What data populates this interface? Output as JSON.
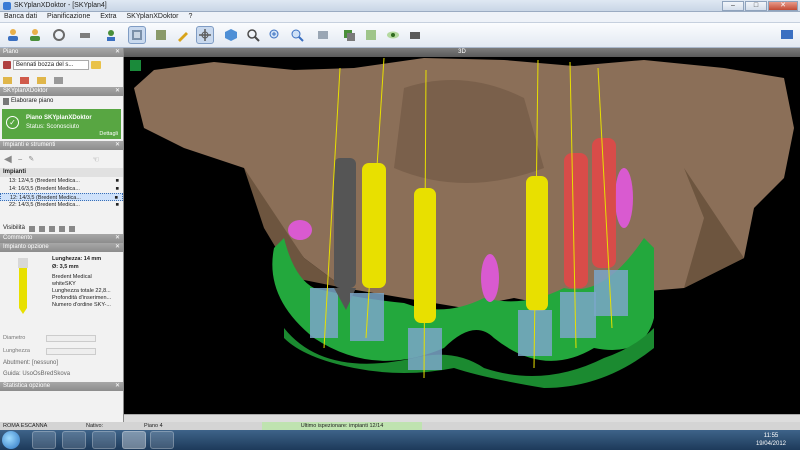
{
  "window": {
    "title": "SKYplanXDoktor - [SKYplan4]"
  },
  "menu": [
    "Banca dati",
    "Pianificazione",
    "Extra",
    "SKYplanXDoktor",
    "?"
  ],
  "left_panel": {
    "piano_header": "Piano",
    "plan_select": "Bennati bozza del s...",
    "doktor_header": "SKYplanXDoktor",
    "elaborare": "Elaborare piano",
    "status_title": "Piano SKYplanXDoktor",
    "status_sub": "Status: Sconosciuto",
    "status_link": "Dettagli",
    "impianti_header": "Impianti e strumenti",
    "tree_header": "Impianti",
    "implants": [
      "13: 12/4,5 (Bredent Medica...",
      "14: 16/3,5 (Bredent Medica...",
      "12: 14/3,5 (Bredent Medica...",
      "22: 14/3,5 (Bredent Medica..."
    ],
    "visibility_label": "Visibilità",
    "commento_header": "Commento",
    "impianto_header": "Impianto opzione",
    "length_label": "Lunghezza: 14 mm",
    "diameter_label": "Ø: 3,5 mm",
    "maker": "Bredent Medical",
    "line": "whiteSKY",
    "total_length": "Lunghezza totale 22,8...",
    "depth": "Profondità d'inserimen...",
    "order": "Numero d'ordine SKY-...",
    "diametro_label": "Diametro",
    "lunghezza_label": "Lunghezza",
    "abutment_label": "Abutment: [nessuno]",
    "guide_label": "Guida: UsoOsBredSkova",
    "stats_header": "Statistica opzione"
  },
  "viewport": {
    "header": "3D"
  },
  "status": {
    "left": "ROMA ESCANNA",
    "mid": "Nativo:",
    "plan": "Piano 4",
    "center": "Ultimo ispezionare: impianti 12/14"
  },
  "clock": {
    "time": "11:55",
    "date": "19/04/2012"
  },
  "colors": {
    "bone": "#8b6f58",
    "gum": "#23a83d",
    "implant_yellow": "#e8e000",
    "implant_red": "#e04848",
    "implant_gray": "#555555",
    "sleeve": "#7aa6c8",
    "nerve": "#d95ad0"
  }
}
